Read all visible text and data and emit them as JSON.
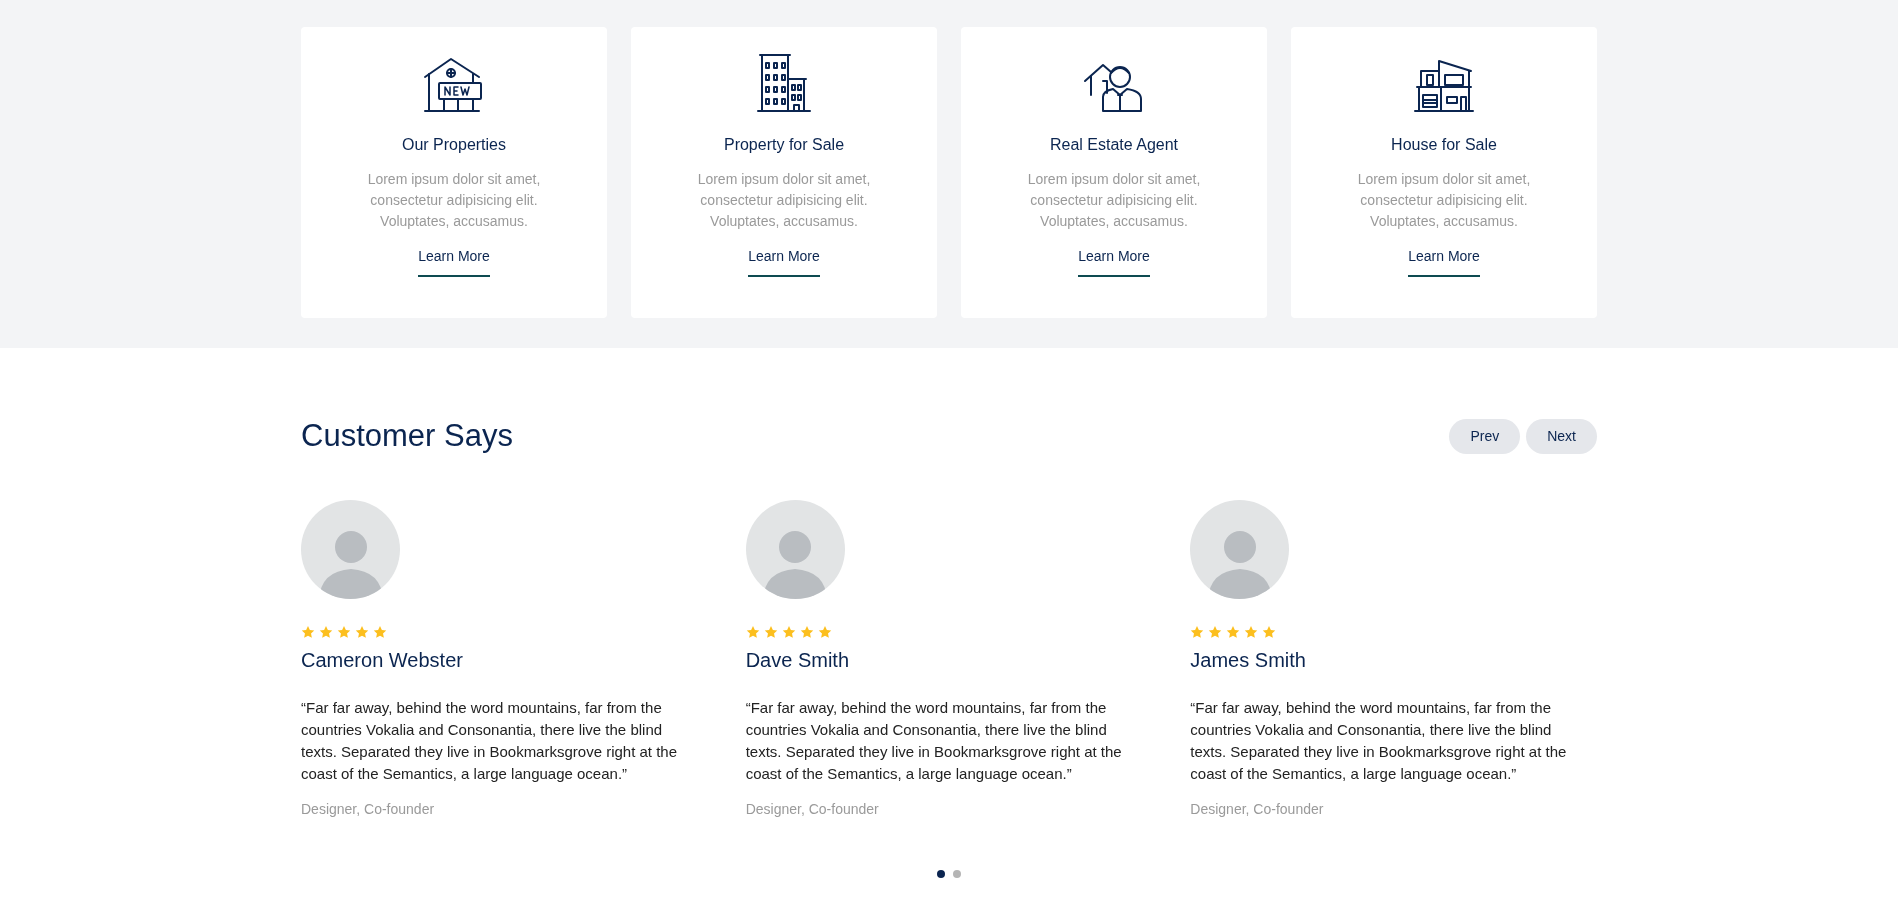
{
  "services": [
    {
      "title": "Our Properties",
      "description": "Lorem ipsum dolor sit amet, consectetur adipisicing elit. Voluptates, accusamus.",
      "link": "Learn More"
    },
    {
      "title": "Property for Sale",
      "description": "Lorem ipsum dolor sit amet, consectetur adipisicing elit. Voluptates, accusamus.",
      "link": "Learn More"
    },
    {
      "title": "Real Estate Agent",
      "description": "Lorem ipsum dolor sit amet, consectetur adipisicing elit. Voluptates, accusamus.",
      "link": "Learn More"
    },
    {
      "title": "House for Sale",
      "description": "Lorem ipsum dolor sit amet, consectetur adipisicing elit. Voluptates, accusamus.",
      "link": "Learn More"
    }
  ],
  "testimonials": {
    "heading": "Customer Says",
    "buttons": [
      "Prev",
      "Next"
    ],
    "items": [
      {
        "stars": 5,
        "name": "Cameron Webster",
        "quote": "“Far far away, behind the word mountains, far from the countries Vokalia and Consonantia, there live the blind texts. Separated they live in Bookmarksgrove right at the coast of the Semantics, a large language ocean.”",
        "role": "Designer, Co-founder"
      },
      {
        "stars": 5,
        "name": "Dave Smith",
        "quote": "“Far far away, behind the word mountains, far from the countries Vokalia and Consonantia, there live the blind texts. Separated they live in Bookmarksgrove right at the coast of the Semantics, a large language ocean.”",
        "role": "Designer, Co-founder"
      },
      {
        "stars": 5,
        "name": "James Smith",
        "quote": "“Far far away, behind the word mountains, far from the countries Vokalia and Consonantia, there live the blind texts. Separated they live in Bookmarksgrove right at the coast of the Semantics, a large language ocean.”",
        "role": "Designer, Co-founder"
      }
    ],
    "dots": [
      {
        "selected": true
      },
      {
        "selected": false
      }
    ]
  }
}
